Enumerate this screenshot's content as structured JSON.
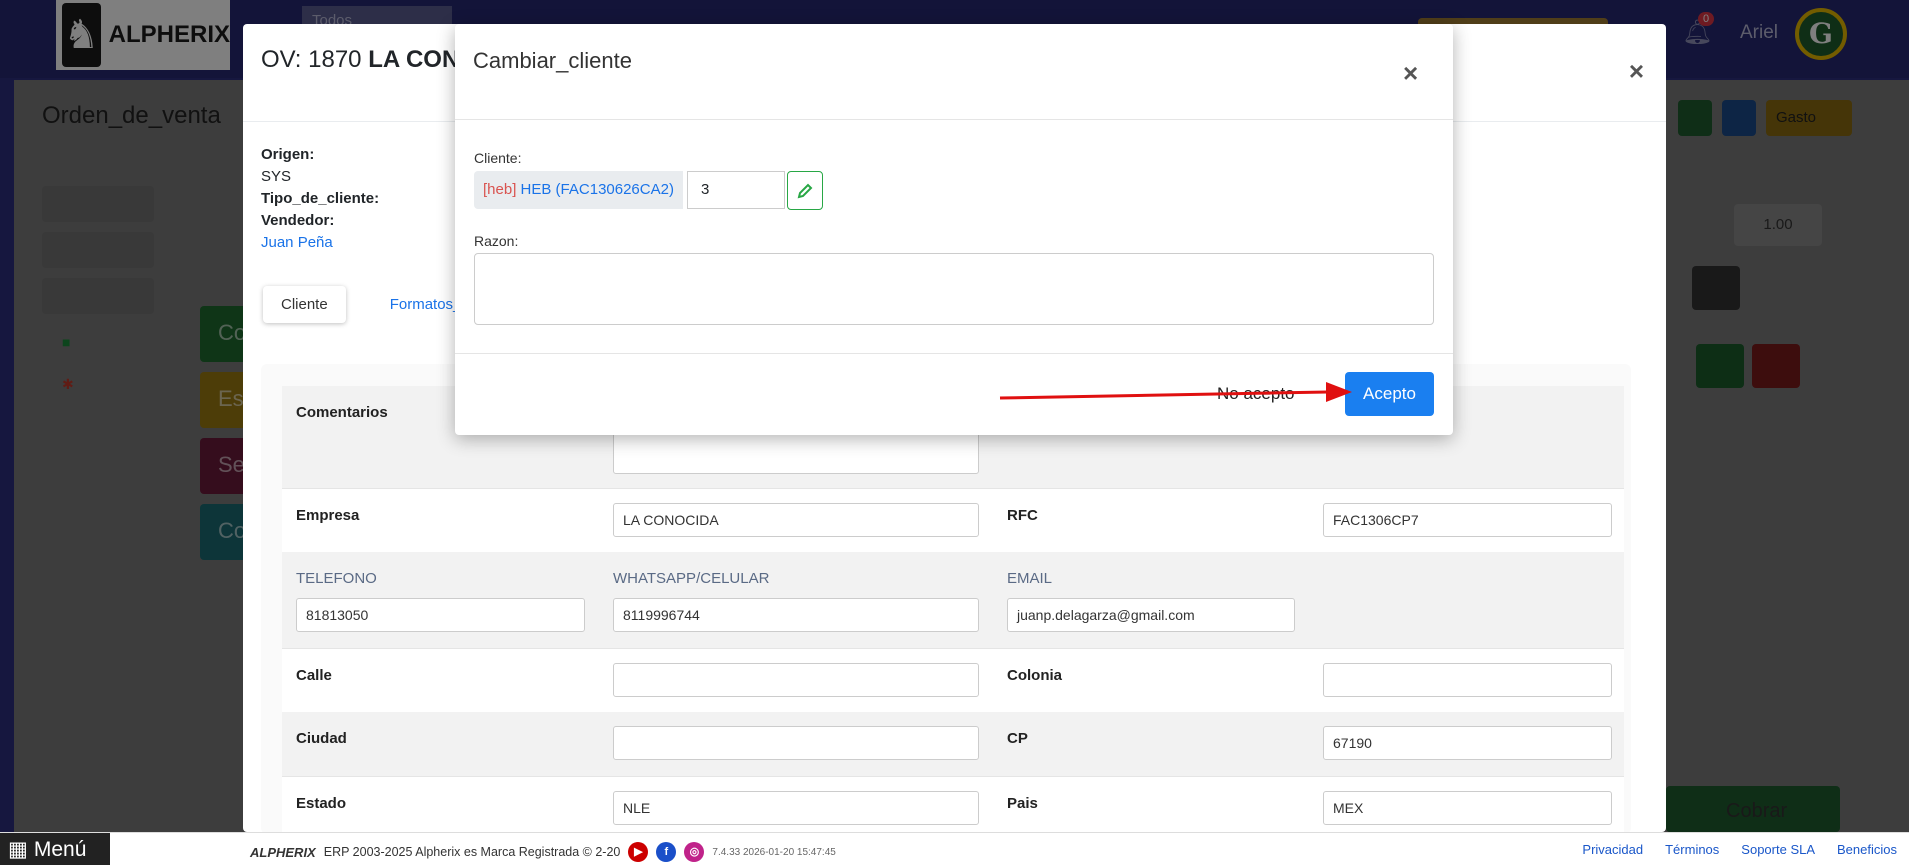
{
  "topbar": {
    "brand": "ALPHERIX",
    "search_value": "Todos",
    "notifications_count": "0",
    "user_name": "Ariel"
  },
  "app": {
    "title": "Orden_de_venta",
    "gasto_label": "Gasto",
    "quantity_value": "1.00",
    "cobrar_label": "Cobrar"
  },
  "ov_modal": {
    "title_prefix": "OV: 1870",
    "title_bold": "LA CONOCIDA",
    "origen_label": "Origen:",
    "origen_value": "SYS",
    "tipo_label": "Tipo_de_cliente:",
    "vendedor_label": "Vendedor:",
    "vendedor_value": "Juan Peña",
    "tabs": [
      "Cliente",
      "Formatos_"
    ],
    "form": {
      "comentarios_label": "Comentarios",
      "empresa_label": "Empresa",
      "empresa_value": "LA CONOCIDA",
      "rfc_label": "RFC",
      "rfc_value": "FAC1306CP7",
      "telefono_label": "TELEFONO",
      "telefono_value": "81813050",
      "whatsapp_label": "WHATSAPP/CELULAR",
      "whatsapp_value": "8119996744",
      "email_label": "EMAIL",
      "email_value": "juanp.delagarza@gmail.com",
      "calle_label": "Calle",
      "calle_value": "",
      "colonia_label": "Colonia",
      "colonia_value": "",
      "ciudad_label": "Ciudad",
      "ciudad_value": "",
      "cp_label": "CP",
      "cp_value": "67190",
      "estado_label": "Estado",
      "estado_value": "NLE",
      "pais_label": "Pais",
      "pais_value": "MEX"
    }
  },
  "cambiar_cliente": {
    "title": "Cambiar_cliente",
    "cliente_label": "Cliente:",
    "cliente_code": "[heb]",
    "cliente_name": "HEB (FAC130626CA2)",
    "cliente_number": "3",
    "razon_label": "Razon:",
    "razon_value": "",
    "decline_label": "No acepto",
    "accept_label": "Acepto"
  },
  "footer": {
    "menu_label": "Menú",
    "brand": "ALPHERIX",
    "copyright": "ERP 2003-2025 Alpherix es Marca Registrada © 2-20",
    "version": "7.4.33  2026-01-20 15:47:45",
    "links": [
      "Privacidad",
      "Términos",
      "Soporte SLA",
      "Beneficios"
    ]
  },
  "colors": {
    "accent": "#1a7ff0",
    "annotation_arrow": "#e01010"
  }
}
